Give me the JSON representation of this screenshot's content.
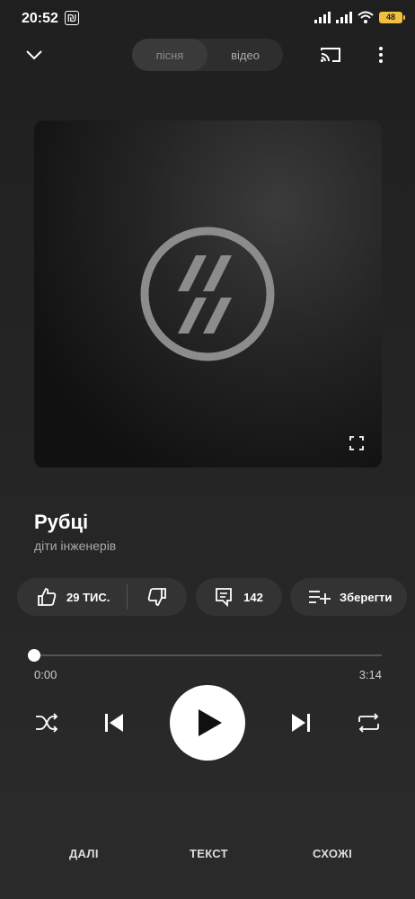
{
  "status": {
    "time": "20:52",
    "battery": "48"
  },
  "toggle": {
    "song": "пісня",
    "video": "відео"
  },
  "track": {
    "title": "Рубці",
    "artist": "діти інженерів"
  },
  "actions": {
    "likes": "29 ТИС.",
    "comments": "142",
    "save": "Зберегти"
  },
  "progress": {
    "current": "0:00",
    "total": "3:14",
    "fraction": 0
  },
  "tabs": {
    "next": "ДАЛІ",
    "lyrics": "ТЕКСТ",
    "related": "СХОЖІ"
  }
}
